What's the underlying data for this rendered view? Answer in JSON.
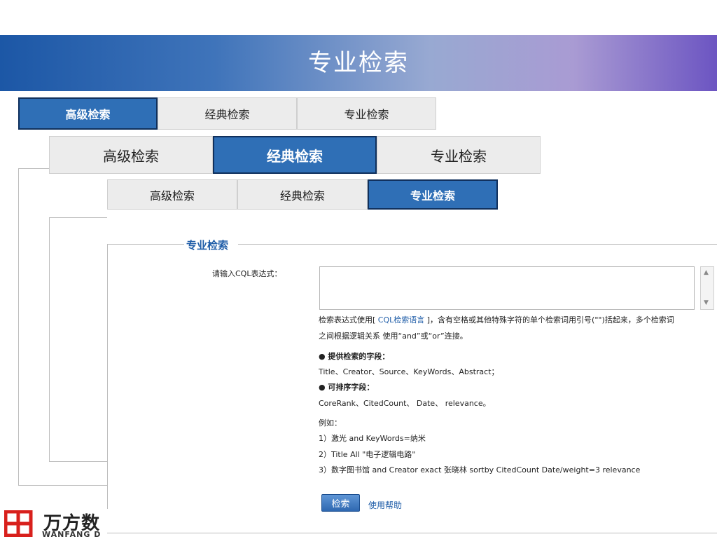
{
  "slide": {
    "title": "专业检索"
  },
  "tabs_row1": [
    {
      "label": "高级检索",
      "active": true
    },
    {
      "label": "经典检索",
      "active": false
    },
    {
      "label": "专业检索",
      "active": false
    }
  ],
  "tabs_row2": [
    {
      "label": "高级检索",
      "active": false
    },
    {
      "label": "经典检索",
      "active": true
    },
    {
      "label": "专业检索",
      "active": false
    }
  ],
  "tabs_row3": [
    {
      "label": "高级检索",
      "active": false
    },
    {
      "label": "经典检索",
      "active": false
    },
    {
      "label": "专业检索",
      "active": true
    }
  ],
  "search_panel": {
    "legend": "专业检索",
    "input_label": "请输入CQL表达式：",
    "input_value": "",
    "help": {
      "line1_pre": "检索表达式使用[ ",
      "cql_link": "CQL检索语言",
      "line1_post": " ]，含有空格或其他特殊字符的单个检索词用引号(\"\")括起来，多个检索词",
      "line2": "之间根据逻辑关系 使用“and”或“or”连接。",
      "fields_heading": "● 提供检索的字段：",
      "fields": "Title、Creator、Source、KeyWords、Abstract；",
      "sort_heading": "● 可排序字段：",
      "sort_fields": "CoreRank、CitedCount、 Date、 relevance。",
      "example_heading": "例如：",
      "examples": [
        "1）激光 and KeyWords=纳米",
        "2）Title All \"电子逻辑电路\"",
        "3）数字图书馆 and Creator exact 张晓林 sortby CitedCount Date/weight=3 relevance"
      ]
    },
    "search_button": "检索",
    "help_link": "使用帮助"
  },
  "logo": {
    "name_cn": "万方数",
    "name_en": "WANFANG D"
  },
  "colors": {
    "accent": "#2f6fb6",
    "link": "#1f5da8",
    "banner_start": "#1c57a6",
    "banner_end": "#6c55c2"
  },
  "icons": {
    "scroll_up": "▲",
    "scroll_down": "▼"
  }
}
